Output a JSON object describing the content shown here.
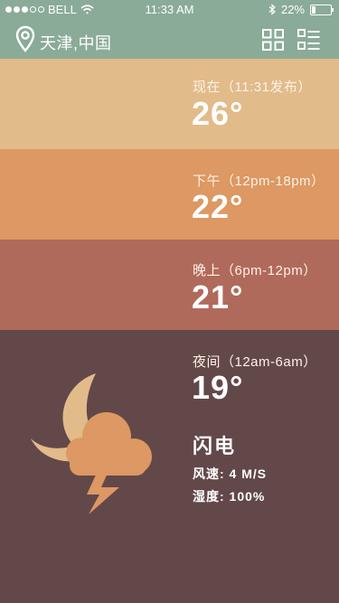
{
  "status_bar": {
    "carrier": "BELL",
    "time": "11:33 AM",
    "battery": "22%",
    "battery_level": 0.22
  },
  "header": {
    "location": "天津,中国",
    "icons": [
      "location-pin-icon",
      "grid-view-icon",
      "list-view-icon"
    ]
  },
  "forecast": [
    {
      "label": "现在（11:31发布）",
      "temp": "26°",
      "color": "#e2bb8a"
    },
    {
      "label": "下午（12pm-18pm）",
      "temp": "22°",
      "color": "#dd9863"
    },
    {
      "label": "晚上（6pm-12pm）",
      "temp": "21°",
      "color": "#b06a5b"
    },
    {
      "label": "夜间（12am-6am）",
      "temp": "19°",
      "color": "#634849"
    }
  ],
  "night": {
    "condition": "闪电",
    "wind": "风速: 4 M/S",
    "humidity": "湿度: 100%",
    "icon": "moon-cloud-lightning-icon"
  },
  "colors": {
    "header": "#8aab97",
    "moon": "#e2bb8a",
    "cloud": "#dd9863"
  }
}
